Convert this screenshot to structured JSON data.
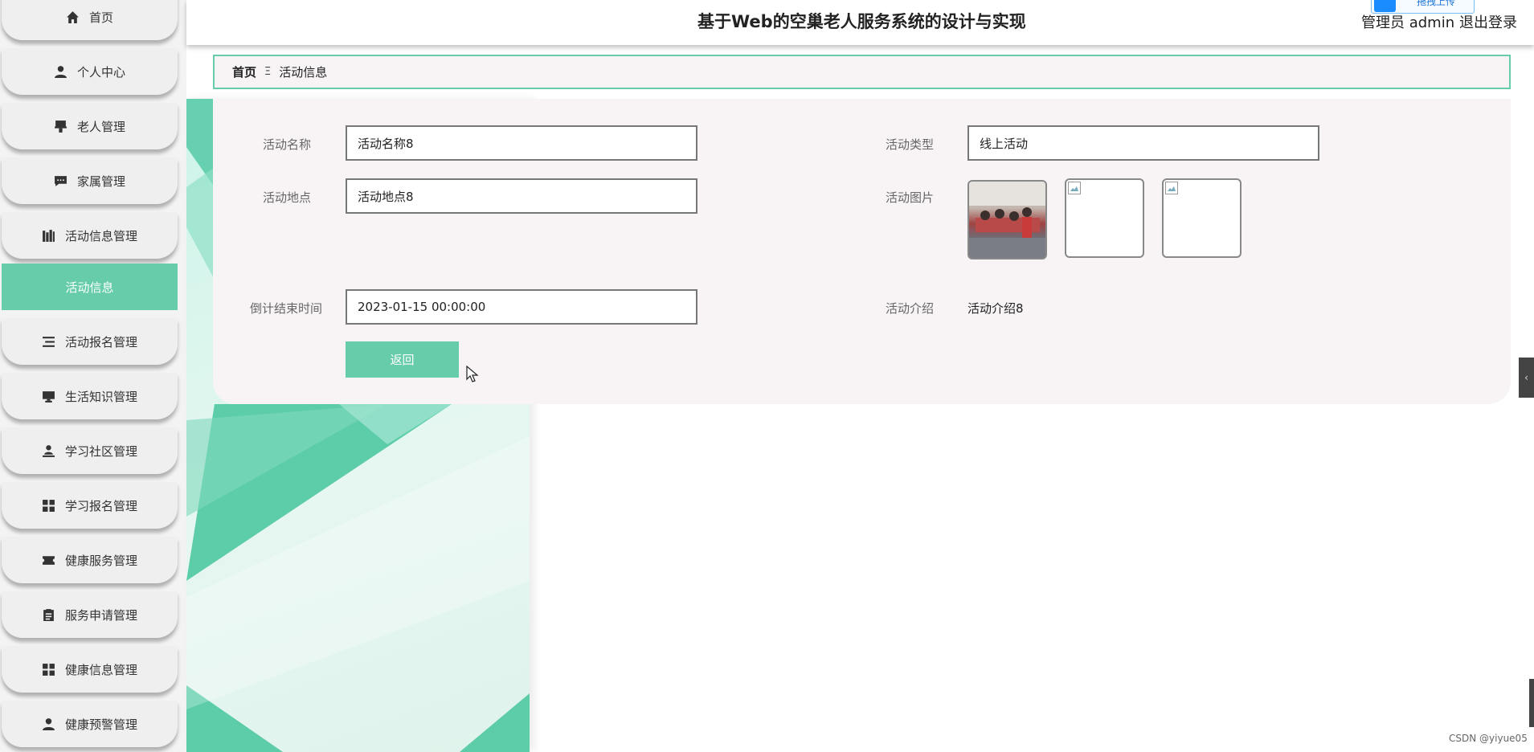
{
  "app": {
    "title": "基于Web的空巢老人服务系统的设计与实现",
    "user_label": "管理员 admin",
    "logout_label": "退出登录",
    "upload_badge": "拖拽上传"
  },
  "sidebar": {
    "items": [
      {
        "label": "首页",
        "icon": "home-icon"
      },
      {
        "label": "个人中心",
        "icon": "user-icon"
      },
      {
        "label": "老人管理",
        "icon": "stamp-icon"
      },
      {
        "label": "家属管理",
        "icon": "chat-icon"
      },
      {
        "label": "活动信息管理",
        "icon": "books-icon"
      },
      {
        "label": "活动信息",
        "icon": "",
        "active": true
      },
      {
        "label": "活动报名管理",
        "icon": "list-icon"
      },
      {
        "label": "生活知识管理",
        "icon": "monitor-icon"
      },
      {
        "label": "学习社区管理",
        "icon": "person-desk-icon"
      },
      {
        "label": "学习报名管理",
        "icon": "grid-icon"
      },
      {
        "label": "健康服务管理",
        "icon": "ticket-icon"
      },
      {
        "label": "服务申请管理",
        "icon": "clipboard-icon"
      },
      {
        "label": "健康信息管理",
        "icon": "grid-icon"
      },
      {
        "label": "健康预警管理",
        "icon": "user-icon"
      }
    ]
  },
  "breadcrumb": {
    "home": "首页",
    "separator": "Ξ",
    "current": "活动信息"
  },
  "form": {
    "name_label": "活动名称",
    "name_value": "活动名称8",
    "type_label": "活动类型",
    "type_value": "线上活动",
    "place_label": "活动地点",
    "place_value": "活动地点8",
    "image_label": "活动图片",
    "end_time_label": "倒计结束时间",
    "end_time_value": "2023-01-15 00:00:00",
    "intro_label": "活动介绍",
    "intro_value": "活动介绍8",
    "back_label": "返回"
  },
  "footer": {
    "watermark": "CSDN @yiyue05"
  },
  "colors": {
    "accent": "#66ccaa",
    "panel": "#f8f4f6",
    "upload_blue": "#1a8cff"
  }
}
